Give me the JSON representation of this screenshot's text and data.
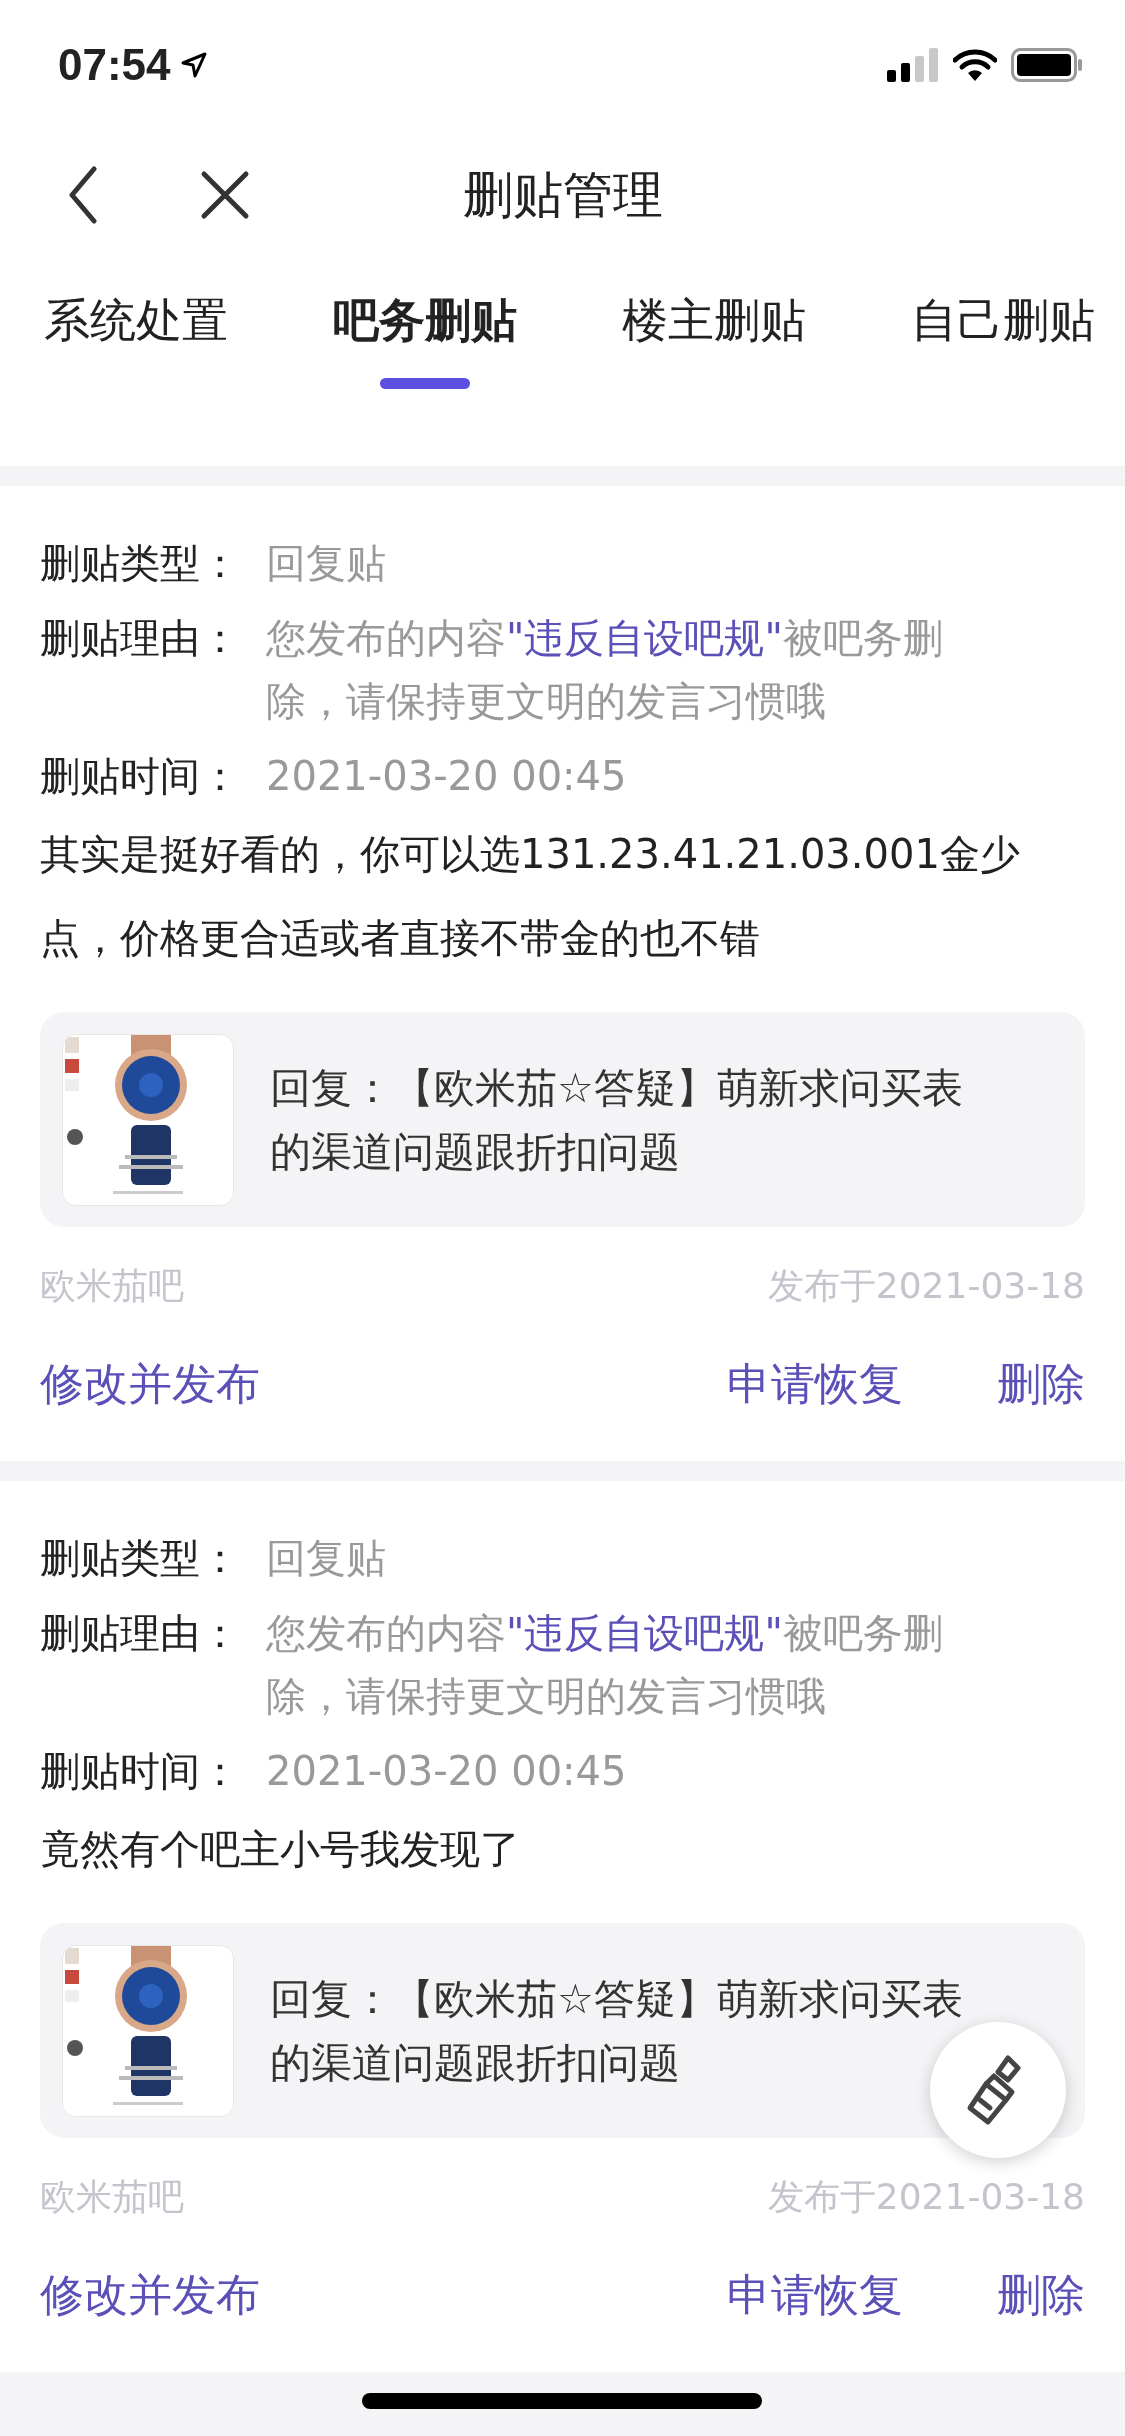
{
  "status_bar": {
    "time": "07:54"
  },
  "nav": {
    "title": "删贴管理"
  },
  "tabs": [
    {
      "label": "系统处置",
      "selected": false
    },
    {
      "label": "吧务删贴",
      "selected": true
    },
    {
      "label": "楼主删贴",
      "selected": false
    },
    {
      "label": "自己删贴",
      "selected": false
    }
  ],
  "posts": [
    {
      "type_label": "删贴类型：",
      "type": "回复贴",
      "reason_label": "删贴理由：",
      "reason_before": "您发布的内容",
      "reason_highlight": "\"违反自设吧规\"",
      "reason_after": "被吧务删除，请保持更文明的发言习惯哦",
      "time_label": "删贴时间：",
      "time": "2021-03-20 00:45",
      "content": "其实是挺好看的，你可以选131.23.41.21.03.001金少点，价格更合适或者直接不带金的也不错",
      "quote": {
        "title": "回复：【欧米茄☆答疑】萌新求问买表的渠道问题跟折扣问题"
      },
      "forum": "欧米茄吧",
      "published": "发布于2021-03-18",
      "actions": [
        "修改并发布",
        "申请恢复",
        "删除"
      ]
    },
    {
      "type_label": "删贴类型：",
      "type": "回复贴",
      "reason_label": "删贴理由：",
      "reason_before": "您发布的内容",
      "reason_highlight": "\"违反自设吧规\"",
      "reason_after": "被吧务删除，请保持更文明的发言习惯哦",
      "time_label": "删贴时间：",
      "time": "2021-03-20 00:45",
      "content": "竟然有个吧主小号我发现了",
      "quote": {
        "title": "回复：【欧米茄☆答疑】萌新求问买表的渠道问题跟折扣问题"
      },
      "forum": "欧米茄吧",
      "published": "发布于2021-03-18",
      "actions": [
        "修改并发布",
        "申请恢复",
        "删除"
      ]
    }
  ]
}
